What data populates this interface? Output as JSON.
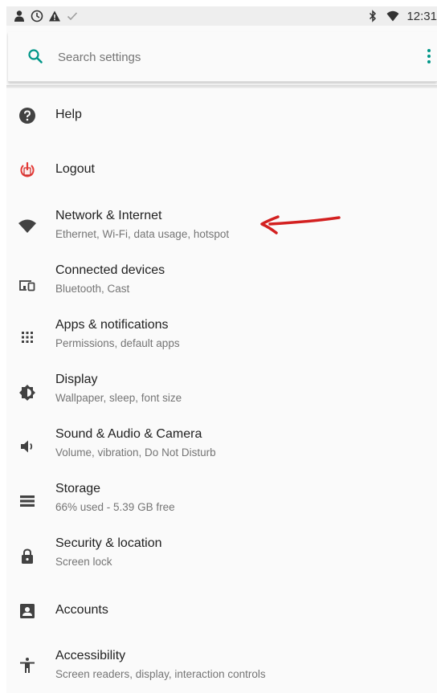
{
  "status_bar": {
    "time": "12:31",
    "left_icons": [
      "person-icon",
      "clock-icon",
      "warning-icon",
      "check-icon"
    ],
    "right_icons": [
      "bluetooth-icon",
      "wifi-icon"
    ]
  },
  "search": {
    "placeholder": "Search settings",
    "accent_color": "#009688"
  },
  "settings": [
    {
      "title": "Help",
      "summary": "",
      "icon": "help-icon"
    },
    {
      "title": "Logout",
      "summary": "",
      "icon": "logout-icon"
    },
    {
      "title": "Network & Internet",
      "summary": "Ethernet, Wi-Fi, data usage, hotspot",
      "icon": "wifi-icon"
    },
    {
      "title": "Connected devices",
      "summary": "Bluetooth, Cast",
      "icon": "devices-icon"
    },
    {
      "title": "Apps & notifications",
      "summary": "Permissions, default apps",
      "icon": "apps-icon"
    },
    {
      "title": "Display",
      "summary": "Wallpaper, sleep, font size",
      "icon": "brightness-icon"
    },
    {
      "title": "Sound & Audio & Camera",
      "summary": "Volume, vibration, Do Not Disturb",
      "icon": "volume-icon"
    },
    {
      "title": "Storage",
      "summary": "66% used - 5.39 GB free",
      "icon": "storage-icon"
    },
    {
      "title": "Security & location",
      "summary": "Screen lock",
      "icon": "lock-icon"
    },
    {
      "title": "Accounts",
      "summary": "",
      "icon": "account-icon"
    },
    {
      "title": "Accessibility",
      "summary": "Screen readers, display, interaction controls",
      "icon": "accessibility-icon"
    }
  ],
  "annotation": {
    "color": "#d32020"
  }
}
